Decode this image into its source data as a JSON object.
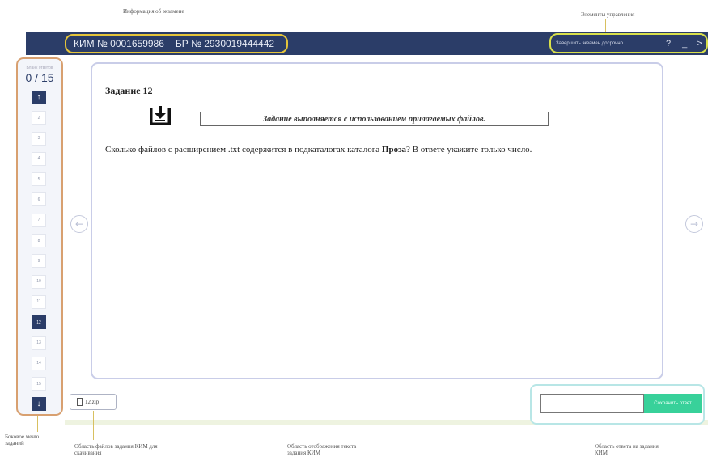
{
  "annotations": {
    "exam_info": "Информация об экзамене",
    "controls": "Элементы управления",
    "sidebar": "Боковое меню заданий",
    "files": "Область файлов задания КИМ для скачивания",
    "task_display": "Область отображения текста задания КИМ",
    "answer": "Область ответа на задания КИМ"
  },
  "header": {
    "kim": "КИМ № 0001659986",
    "br": "БР № 2930019444442",
    "finish_label": "Завершить экзамен досрочно",
    "help_label": "?",
    "minimize_label": "_",
    "next_label": ">"
  },
  "sidebar": {
    "blank_label": "Бланк ответов",
    "progress": "0 / 15",
    "up_label": "↑",
    "down_label": "↓",
    "tasks": [
      "2",
      "3",
      "4",
      "5",
      "6",
      "7",
      "8",
      "9",
      "10",
      "11",
      "12",
      "13",
      "14",
      "15"
    ],
    "active_task": "12"
  },
  "task": {
    "title": "Задание 12",
    "file_note": "Задание выполняется с использованием прилагаемых файлов.",
    "question_before": "Сколько файлов с расширением .txt содержится в подкаталогах каталога ",
    "question_bold": "Проза",
    "question_after": "? В ответе укажите только число."
  },
  "files": {
    "name": "12.zip"
  },
  "answer": {
    "value": "",
    "save_label": "Сохранить ответ"
  },
  "colors": {
    "topbar": "#2b3d68",
    "exam_info_outline": "#e5c53a",
    "sidebar_outline": "#d8a070",
    "save_button": "#38d19a",
    "answer_outline": "#b8e6e6"
  }
}
